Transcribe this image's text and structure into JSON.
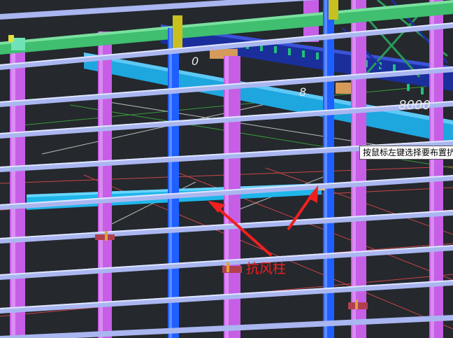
{
  "tooltip": {
    "text": "按鼠标左键选择要布置抗风柱"
  },
  "annotation": {
    "label": "抗风柱"
  },
  "dimensions": [
    {
      "text": "0"
    },
    {
      "text": "8"
    },
    {
      "text": "8000"
    }
  ],
  "colors": {
    "background": "#25282d",
    "column_magenta": "#c65ee6",
    "wind_column_blue": "#1f5fff",
    "purlin": "#a9b6f0",
    "beam_cyan": "#22a6e6",
    "green_beam": "#3fbf6f",
    "annotation_red": "#f02020",
    "grid_red": "#c84646"
  }
}
